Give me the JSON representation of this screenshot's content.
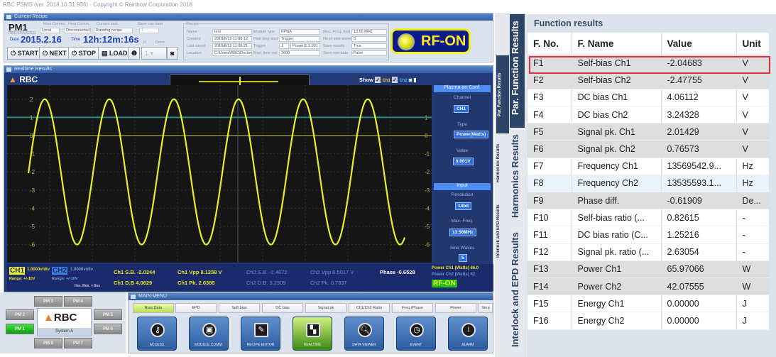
{
  "title": "RBC PSMS (ver. 2018.10.31.936)  -  Copyright © Rainbow Corporation 2018",
  "recipe_panel": {
    "header": "Current Recipe",
    "pm": "PM1",
    "pm_sub": "RBC-DVUG/EG",
    "host_control_label": "Host Control",
    "host_control": "Local",
    "host_comm_label": "Host Comm.",
    "host_comm": "Disconnected",
    "current_task_label": "Current task",
    "current_task": "Running recipe",
    "save_raw_label": "Save raw data",
    "save_raw_value": "1",
    "date_label": "Date",
    "date": "2015.2.16",
    "time_label": "Time",
    "time": "12h:12m:16s",
    "zero": "0",
    "done": "Done",
    "buttons": {
      "start": "START",
      "next": "NEXT",
      "stop": "STOP",
      "load": "LOAD"
    },
    "step_value": "1",
    "recipe": {
      "group": "Recipe",
      "name_label": "Name",
      "name": "test",
      "created_label": "Created",
      "created": "2018/6/13 11:08:12",
      "last_saved_label": "Last saved",
      "last_saved": "2018/6/13 11:08:21",
      "location_label": "Location",
      "location": "C:\\Users\\RBC\\Docum",
      "module_type_label": "Module type",
      "module_type": "FPGA",
      "first_step_label": "First step start",
      "first_step": "Trigger",
      "trigger_label": "Trigger",
      "trigger": "1",
      "trigger_src": "Power(1.2.001",
      "max_time_label": "Max. time out",
      "max_time": "3600",
      "mon_freq_label": "Mon. Freq. (Hz)",
      "mon_freq": "13.56 MHz",
      "sine_waves_label": "No of sine waves",
      "sine_waves": "5",
      "save_results_label": "Save results",
      "save_results": "True",
      "save_raw_label": "Save raw data",
      "save_raw": "False"
    }
  },
  "rf_status": "RF-ON",
  "realtime": {
    "header": "Realtime Results",
    "brand": "RBC",
    "show_label": "Show",
    "ch1": "Ch1",
    "ch2": "Ch2",
    "trigger_marker": "T",
    "y_ticks": [
      "2",
      "1",
      "0",
      "-1",
      "-2",
      "-3",
      "-4",
      "-5",
      "-6"
    ],
    "plasma_conf": {
      "header": "Plasma on Conf.",
      "channel_label": "Channel",
      "channel": "CH1",
      "type_label": "Type",
      "type": "Power(Watts)",
      "value_label": "Value",
      "value": "0.001V"
    },
    "input": {
      "header": "Input",
      "resolution_label": "Resolution",
      "resolution": "14bit",
      "max_freq_label": "Max. Freq.",
      "max_freq": "13.56MHz",
      "sine_label": "Sine Waves",
      "sine": "5"
    }
  },
  "status": {
    "ch1": "CH1",
    "ch1_div": "1.0000v/div",
    "ch1_range": "Range: +/-10V",
    "ch2": "CH2",
    "ch2_div": "1.0000v/div",
    "ch2_range": "Range: +/-10V",
    "hor": "Hor. Res. = 8ns",
    "ch1_sb": "Ch1 S.B. -2.0244",
    "ch1_db": "Ch1 D.B 4.0629",
    "ch1_vpp": "Ch1 Vpp  8.1258 V",
    "ch1_pk": "Ch1 Pk.   2.0385",
    "ch2_sb": "Ch2 S.B. -2.4672",
    "ch2_db": "Ch2 D.B. 3.2509",
    "ch2_vpp": "Ch2 Vpp  6.5017 V",
    "ch2_pk": "Ch2 Pk.   0.7837",
    "phase": "Phase -0.6528",
    "power_ch1": "Power Ch1 (Watts)  66.0",
    "power_ch2": "Power Ch2 (Watts)  42.",
    "rf": "RF-ON"
  },
  "pm_panel": {
    "brand": "RBC",
    "system": "System A",
    "modules": [
      "PM 1",
      "PM 2",
      "PM 3",
      "PM 4",
      "PM 5",
      "PM 6",
      "PM 7",
      "PM 8"
    ],
    "active": "PM 1"
  },
  "main_menu": {
    "header": "MAIN MENU",
    "tabs": [
      "Raw Data",
      "EPD",
      "Self-bias",
      "DC bias",
      "Signal pk",
      "Ch1/Ch2 Ratio",
      "Freq./Phase",
      "Power",
      "Step"
    ],
    "active_tab": "Raw Data",
    "buttons": [
      {
        "label": "ACCESS",
        "icon": "key-icon"
      },
      {
        "label": "MODULE COMM.",
        "icon": "chip-icon"
      },
      {
        "label": "RECIPE EDITOR",
        "icon": "edit-icon"
      },
      {
        "label": "REALTIME",
        "icon": "chart-icon"
      },
      {
        "label": "DATA VIEWER",
        "icon": "magnifier-icon"
      },
      {
        "label": "EVENT",
        "icon": "clock-icon"
      },
      {
        "label": "ALARM",
        "icon": "shield-alert-icon"
      }
    ],
    "active_button": "REALTIME"
  },
  "side_tabs": [
    "Par. Function Results",
    "Harmonics Results",
    "Interlock and EPD Results"
  ],
  "function_results": {
    "title": "Function results",
    "columns": [
      "F. No.",
      "F. Name",
      "Value",
      "Unit"
    ],
    "rows": [
      [
        "F1",
        "Self-bias Ch1",
        "-2.04683",
        "V"
      ],
      [
        "F2",
        "Self-bias Ch2",
        "-2.47755",
        "V"
      ],
      [
        "F3",
        "DC bias Ch1",
        "4.06112",
        "V"
      ],
      [
        "F4",
        "DC bias Ch2",
        "3.24328",
        "V"
      ],
      [
        "F5",
        "Signal pk. Ch1",
        "2.01429",
        "V"
      ],
      [
        "F6",
        "Signal pk. Ch2",
        "0.76573",
        "V"
      ],
      [
        "F7",
        "Frequency Ch1",
        "13569542.9...",
        "Hz"
      ],
      [
        "F8",
        "Frequency Ch2",
        "13535593.1...",
        "Hz"
      ],
      [
        "F9",
        "Phase diff.",
        "-0.61909",
        "De..."
      ],
      [
        "F10",
        "Self-bias ratio (...",
        "0.82615",
        "-"
      ],
      [
        "F11",
        "DC bias ratio (C...",
        "1.25216",
        "-"
      ],
      [
        "F12",
        "Signal pk. ratio (...",
        "2.63054",
        "-"
      ],
      [
        "F13",
        "Power Ch1",
        "65.97066",
        "W"
      ],
      [
        "F14",
        "Power Ch2",
        "42.07555",
        "W"
      ],
      [
        "F15",
        "Energy Ch1",
        "0.00000",
        "J"
      ],
      [
        "F16",
        "Energy Ch2",
        "0.00000",
        "J"
      ]
    ],
    "selected_row": "F1"
  },
  "colors": {
    "trace": "#e8f020",
    "rf_on": "#ffe820",
    "accent": "#2f5da6",
    "selection": "#e03040"
  }
}
